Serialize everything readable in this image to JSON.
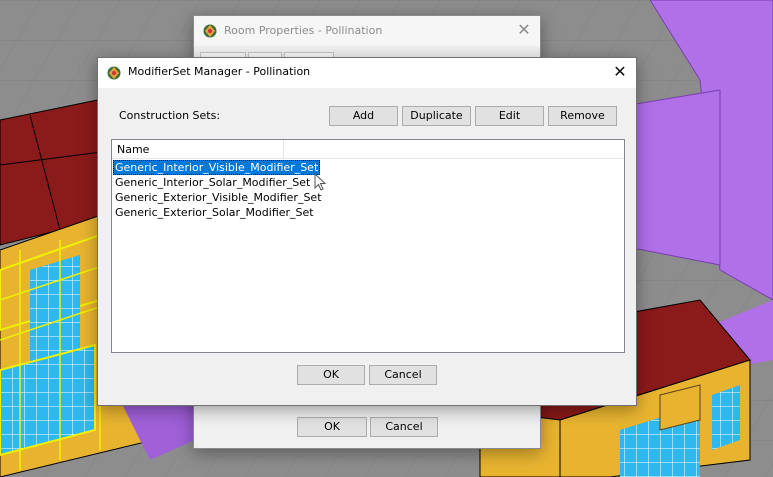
{
  "room_window": {
    "title": "Room Properties - Pollination",
    "ok_label": "OK",
    "cancel_label": "Cancel"
  },
  "manager_window": {
    "title": "ModifierSet Manager - Pollination",
    "construction_sets_label": "Construction Sets:",
    "buttons": {
      "add": "Add",
      "duplicate": "Duplicate",
      "edit": "Edit",
      "remove": "Remove"
    },
    "list": {
      "column_name": "Name",
      "items": [
        "Generic_Interior_Visible_Modifier_Set",
        "Generic_Interior_Solar_Modifier_Set",
        "Generic_Exterior_Visible_Modifier_Set",
        "Generic_Exterior_Solar_Modifier_Set"
      ],
      "selected_index": 0
    },
    "ok_label": "OK",
    "cancel_label": "Cancel"
  },
  "colors": {
    "accent_selection": "#0078d7",
    "roof_red": "#8b1a1a",
    "wall_orange": "#e8b430",
    "window_blue": "#2fb8f0",
    "wireframe_yellow": "#f0f000",
    "purple_surface": "#b070e8"
  },
  "icons": {
    "app": "pollination-logo-icon",
    "close": "close-icon",
    "cursor": "mouse-pointer-icon"
  }
}
